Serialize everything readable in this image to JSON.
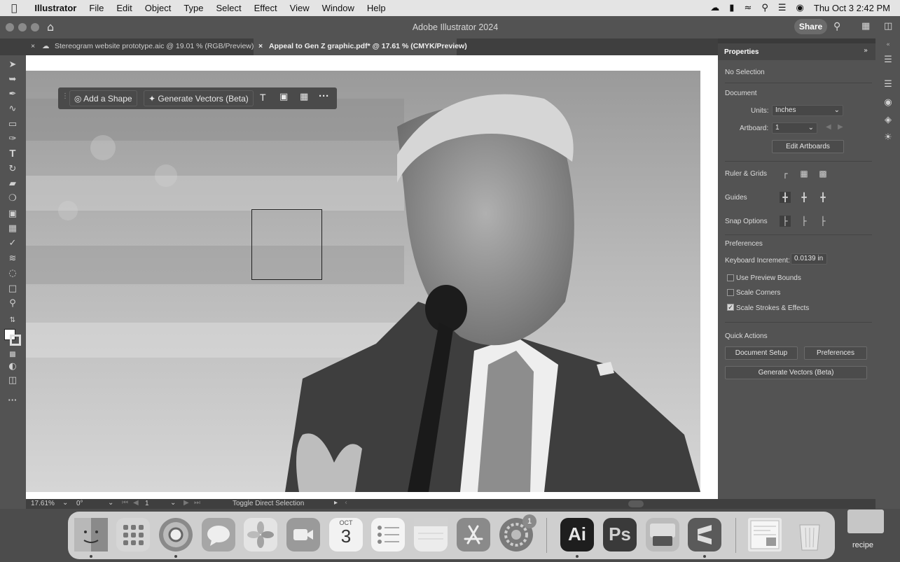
{
  "menubar": {
    "app_name": "Illustrator",
    "items": [
      "File",
      "Edit",
      "Object",
      "Type",
      "Select",
      "Effect",
      "View",
      "Window",
      "Help"
    ],
    "clock": "Thu Oct 3  2:42 PM"
  },
  "window": {
    "title": "Adobe Illustrator 2024",
    "share_label": "Share"
  },
  "tabs": [
    {
      "label": "Stereogram website prototype.aic @ 19.01 % (RGB/Preview)"
    },
    {
      "label": "Appeal to Gen Z graphic.pdf* @ 17.61 % (CMYK/Preview)"
    }
  ],
  "context_bar": {
    "add_shape": "Add a Shape",
    "generate_vectors": "Generate Vectors (Beta)"
  },
  "status": {
    "zoom": "17.61%",
    "rotation": "0°",
    "artboard": "1",
    "tool_hint": "Toggle Direct Selection"
  },
  "properties": {
    "title": "Properties",
    "selection": "No Selection",
    "document_heading": "Document",
    "units_label": "Units:",
    "units_value": "Inches",
    "artboard_label": "Artboard:",
    "artboard_value": "1",
    "edit_artboards": "Edit Artboards",
    "ruler_grids": "Ruler & Grids",
    "guides": "Guides",
    "snap_options": "Snap Options",
    "preferences_heading": "Preferences",
    "keyboard_increment_label": "Keyboard Increment:",
    "keyboard_increment_value": "0.0139 in",
    "use_preview_bounds": "Use Preview Bounds",
    "use_preview_bounds_checked": false,
    "scale_corners": "Scale Corners",
    "scale_corners_checked": false,
    "scale_strokes": "Scale Strokes & Effects",
    "scale_strokes_checked": true,
    "quick_actions_heading": "Quick Actions",
    "document_setup": "Document Setup",
    "preferences_button": "Preferences",
    "generate_vectors": "Generate Vectors (Beta)"
  },
  "dock": {
    "calendar_month": "OCT",
    "calendar_day": "3",
    "settings_badge": "1",
    "ai_label": "Ai",
    "ps_label": "Ps",
    "desktop_label": "recipe"
  }
}
